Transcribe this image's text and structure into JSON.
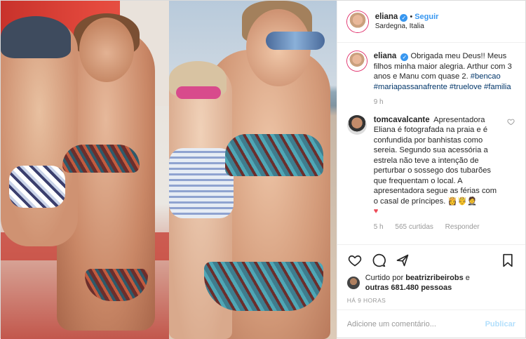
{
  "header": {
    "username": "eliana",
    "verified": true,
    "separator": "•",
    "follow_label": "Seguir",
    "location": "Sardegna, Italia"
  },
  "caption": {
    "username": "eliana",
    "text": "Obrigada meu Deus!! Meus filhos minha maior alegria. Arthur com 3 anos e Manu com quase 2.",
    "hashtags": "#bencao #mariapassanafrente #truelove #familia",
    "time": "9 h"
  },
  "comment": {
    "username": "tomcavalcante",
    "text": "Apresentadora Eliana é fotografada na praia e é confundida por banhistas como sereia. Segundo sua acessória a estrela não teve a intenção de perturbar o sossego dos tubarões que frequentam o local. A apresentadora segue as férias com o casal de príncipes. 👸🤴🤵",
    "emoji_tail": "♥",
    "time": "5 h",
    "likes": "565 curtidas",
    "reply_label": "Responder"
  },
  "likes": {
    "prefix": "Curtido por",
    "first_user": "beatrizribeirobs",
    "connector": "e",
    "others": "outras 681.480 pessoas"
  },
  "post_time": "HÁ 9 HORAS",
  "add_comment": {
    "placeholder": "Adicione um comentário...",
    "publish_label": "Publicar"
  },
  "colors": {
    "accent": "#3897f0",
    "hashtag": "#003569",
    "muted": "#999999"
  },
  "icons": [
    "heart-icon",
    "comment-icon",
    "share-icon",
    "bookmark-icon",
    "verified-icon",
    "small-heart-icon"
  ]
}
